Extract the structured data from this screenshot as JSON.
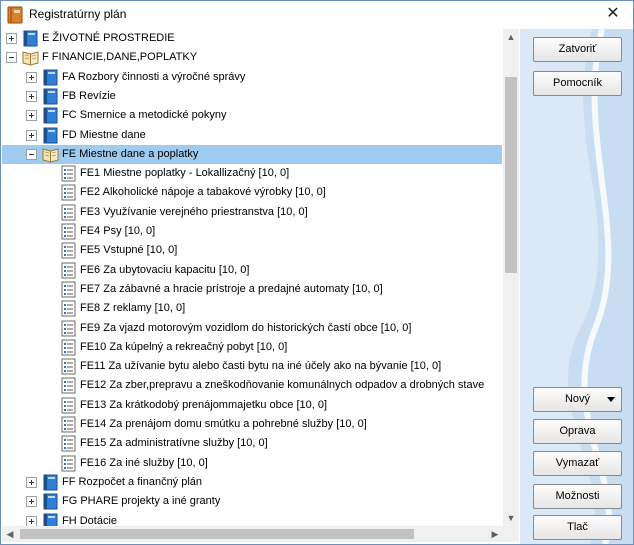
{
  "window": {
    "title": "Registratúrny plán",
    "close_glyph": "✕"
  },
  "tree": [
    {
      "code": "E",
      "label": "ŽIVOTNÉ PROSTREDIE",
      "level": 0,
      "expander": "plus",
      "icon": "book-closed-icon"
    },
    {
      "code": "F",
      "label": "FINANCIE,DANE,POPLATKY",
      "level": 0,
      "expander": "minus",
      "icon": "book-open-icon"
    },
    {
      "code": "FA",
      "label": "Rozbory činnosti a výročné správy",
      "level": 1,
      "expander": "plus",
      "icon": "book-closed-icon"
    },
    {
      "code": "FB",
      "label": "Revízie",
      "level": 1,
      "expander": "plus",
      "icon": "book-closed-icon"
    },
    {
      "code": "FC",
      "label": "Smernice a metodické pokyny",
      "level": 1,
      "expander": "plus",
      "icon": "book-closed-icon"
    },
    {
      "code": "FD",
      "label": "Miestne dane",
      "level": 1,
      "expander": "plus",
      "icon": "book-closed-icon"
    },
    {
      "code": "FE",
      "label": "Miestne dane a poplatky",
      "level": 1,
      "expander": "minus",
      "icon": "book-open-icon",
      "selected": true
    },
    {
      "code": "FE1",
      "label": "Miestne poplatky - Lokallizačný [10, 0]",
      "level": 2,
      "expander": "none",
      "icon": "document-list-icon"
    },
    {
      "code": "FE2",
      "label": "Alkoholické nápoje a tabakové výrobky [10, 0]",
      "level": 2,
      "expander": "none",
      "icon": "document-list-icon"
    },
    {
      "code": "FE3",
      "label": "Využívanie verejného priestranstva [10, 0]",
      "level": 2,
      "expander": "none",
      "icon": "document-list-icon"
    },
    {
      "code": "FE4",
      "label": "Psy [10, 0]",
      "level": 2,
      "expander": "none",
      "icon": "document-list-icon"
    },
    {
      "code": "FE5",
      "label": "Vstupné [10, 0]",
      "level": 2,
      "expander": "none",
      "icon": "document-list-icon"
    },
    {
      "code": "FE6",
      "label": "Za ubytovaciu kapacitu [10, 0]",
      "level": 2,
      "expander": "none",
      "icon": "document-list-icon"
    },
    {
      "code": "FE7",
      "label": "Za zábavné a hracie prístroje a predajné automaty [10, 0]",
      "level": 2,
      "expander": "none",
      "icon": "document-list-icon"
    },
    {
      "code": "FE8",
      "label": "Z reklamy [10, 0]",
      "level": 2,
      "expander": "none",
      "icon": "document-list-icon"
    },
    {
      "code": "FE9",
      "label": "Za vjazd motorovým vozidlom do historických častí obce [10, 0]",
      "level": 2,
      "expander": "none",
      "icon": "document-list-icon"
    },
    {
      "code": "FE10",
      "label": "Za kúpelný a rekreačný pobyt [10, 0]",
      "level": 2,
      "expander": "none",
      "icon": "document-list-icon"
    },
    {
      "code": "FE11",
      "label": "Za užívanie bytu alebo časti bytu na iné účely ako na bývanie [10, 0]",
      "level": 2,
      "expander": "none",
      "icon": "document-list-icon"
    },
    {
      "code": "FE12",
      "label": "Za zber,prepravu a zneškodňovanie komunálnych odpadov a drobných stave",
      "level": 2,
      "expander": "none",
      "icon": "document-list-icon"
    },
    {
      "code": "FE13",
      "label": "Za  krátkodobý prenájommajetku obce [10, 0]",
      "level": 2,
      "expander": "none",
      "icon": "document-list-icon"
    },
    {
      "code": "FE14",
      "label": "Za prenájom  domu smútku a pohrebné služby [10, 0]",
      "level": 2,
      "expander": "none",
      "icon": "document-list-icon"
    },
    {
      "code": "FE15",
      "label": "Za  administratívne  služby [10, 0]",
      "level": 2,
      "expander": "none",
      "icon": "document-list-icon"
    },
    {
      "code": "FE16",
      "label": "Za  iné  služby [10, 0]",
      "level": 2,
      "expander": "none",
      "icon": "document-list-icon"
    },
    {
      "code": "FF",
      "label": "Rozpočet a finančný plán",
      "level": 1,
      "expander": "plus",
      "icon": "book-closed-icon"
    },
    {
      "code": "FG",
      "label": "PHARE projekty a iné granty",
      "level": 1,
      "expander": "plus",
      "icon": "book-closed-icon"
    },
    {
      "code": "FH",
      "label": "Dotácie",
      "level": 1,
      "expander": "plus",
      "icon": "book-closed-icon"
    },
    {
      "code": "",
      "label": "",
      "level": 1,
      "expander": "plus",
      "icon": "book-closed-icon",
      "partial": true
    }
  ],
  "buttons": {
    "close": "Zatvoriť",
    "help": "Pomocník",
    "new": "Nový",
    "edit": "Oprava",
    "delete": "Vymazať",
    "options": "Možnosti",
    "print": "Tlač"
  },
  "scroll": {
    "up": "▲",
    "down": "▼",
    "left": "◀",
    "right": "▶"
  },
  "colors": {
    "selection": "#9fcbf0",
    "panel": "#dbe9f6",
    "book_blue": "#2f7fd6"
  }
}
